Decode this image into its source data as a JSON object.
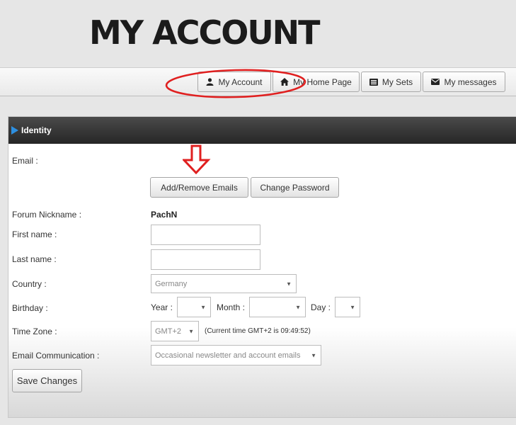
{
  "page": {
    "title": "MY ACCOUNT"
  },
  "nav": {
    "items": [
      {
        "label": "My Account",
        "icon": "user-icon"
      },
      {
        "label": "My Home Page",
        "icon": "home-icon"
      },
      {
        "label": "My Sets",
        "icon": "list-icon"
      },
      {
        "label": "My messages",
        "icon": "envelope-icon"
      }
    ]
  },
  "panel": {
    "title": "Identity"
  },
  "form": {
    "email_label": "Email :",
    "add_remove_emails": "Add/Remove Emails",
    "change_password": "Change Password",
    "nickname_label": "Forum Nickname :",
    "nickname_value": "PachN",
    "first_name_label": "First name :",
    "first_name_value": "",
    "last_name_label": "Last name :",
    "last_name_value": "",
    "country_label": "Country :",
    "country_value": "Germany",
    "birthday_label": "Birthday :",
    "year_label": "Year :",
    "month_label": "Month :",
    "day_label": "Day :",
    "timezone_label": "Time Zone :",
    "timezone_value": "GMT+2",
    "timezone_note": "(Current time GMT+2 is 09:49:52)",
    "email_comm_label": "Email Communication :",
    "email_comm_value": "Occasional newsletter and account emails",
    "save_button": "Save Changes"
  },
  "colors": {
    "annotation": "#e02020",
    "header_bg": "#2b2b2b",
    "header_triangle": "#2d8fe0"
  }
}
